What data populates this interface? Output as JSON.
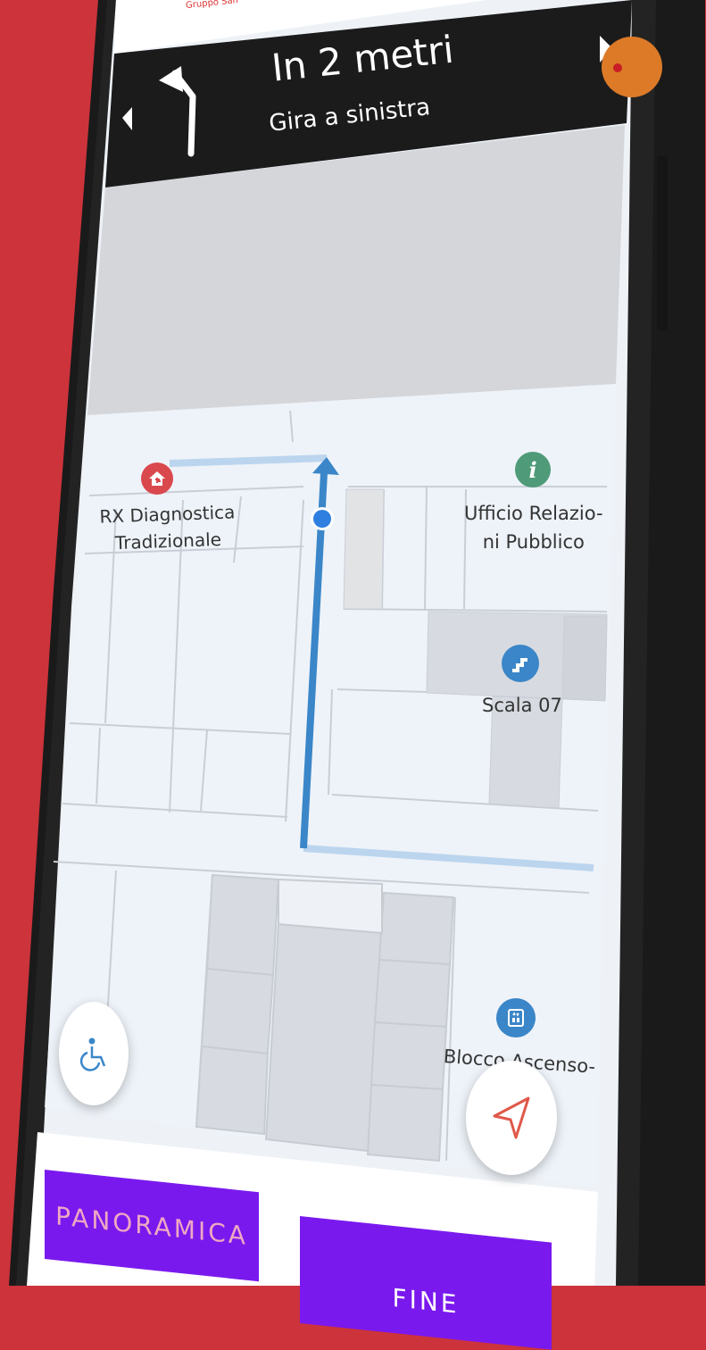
{
  "brand": {
    "tiny_text": "Gruppo San"
  },
  "navigation": {
    "distance": "In 2 metri",
    "instruction": "Gira a sinistra"
  },
  "pois": [
    {
      "id": "rx",
      "label_line1": "RX Diagnostica",
      "label_line2": "Tradizionale",
      "icon": "house-icon",
      "color": "#d9484d"
    },
    {
      "id": "urp",
      "label_line1": "Ufficio Relazio-",
      "label_line2": "ni Pubblico",
      "icon": "info-icon",
      "color": "#4f9a78"
    },
    {
      "id": "stairs",
      "label_line1": "Scala 07",
      "label_line2": "",
      "icon": "stairs-icon",
      "color": "#3a86c8"
    },
    {
      "id": "elevator",
      "label_line1": "Blocco Ascenso-",
      "label_line2": "",
      "icon": "elevator-icon",
      "color": "#3a86c8"
    }
  ],
  "buttons": {
    "overview": "PANORAMICA",
    "end": "FINE"
  },
  "colors": {
    "background": "#cc333b",
    "route": "#3a86c8",
    "banner": "#1b1b1b",
    "button": "#7a19ee"
  }
}
